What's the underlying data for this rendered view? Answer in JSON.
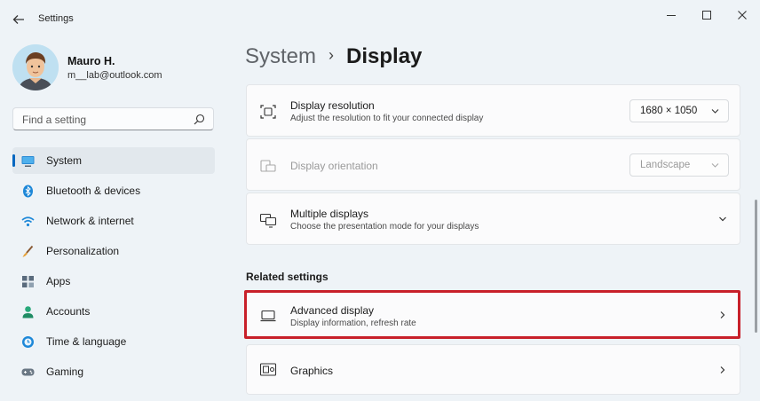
{
  "window": {
    "app_title": "Settings",
    "back_icon": "back-arrow-icon",
    "controls": [
      "minimize-icon",
      "maximize-icon",
      "close-icon"
    ]
  },
  "profile": {
    "name": "Mauro H.",
    "email": "m__lab@outlook.com"
  },
  "search": {
    "placeholder": "Find a setting",
    "value": ""
  },
  "sidebar": {
    "items": [
      {
        "label": "System",
        "icon": "monitor-icon",
        "active": true
      },
      {
        "label": "Bluetooth & devices",
        "icon": "bluetooth-icon"
      },
      {
        "label": "Network & internet",
        "icon": "wifi-icon"
      },
      {
        "label": "Personalization",
        "icon": "brush-icon"
      },
      {
        "label": "Apps",
        "icon": "apps-icon"
      },
      {
        "label": "Accounts",
        "icon": "person-icon"
      },
      {
        "label": "Time & language",
        "icon": "globe-clock-icon"
      },
      {
        "label": "Gaming",
        "icon": "gamepad-icon"
      }
    ]
  },
  "header": {
    "parent": "System",
    "separator": "›",
    "current": "Display"
  },
  "settings": {
    "resolution": {
      "title": "Display resolution",
      "subtitle": "Adjust the resolution to fit your connected display",
      "value": "1680 × 1050",
      "icon": "resolution-icon"
    },
    "orientation": {
      "title": "Display orientation",
      "value": "Landscape",
      "disabled": true,
      "icon": "orientation-icon"
    },
    "multiple": {
      "title": "Multiple displays",
      "subtitle": "Choose the presentation mode for your displays",
      "icon": "multiple-displays-icon"
    }
  },
  "related": {
    "heading": "Related settings",
    "advanced": {
      "title": "Advanced display",
      "subtitle": "Display information, refresh rate",
      "icon": "laptop-icon",
      "highlighted": true
    },
    "graphics": {
      "title": "Graphics",
      "icon": "graphics-icon"
    }
  },
  "colors": {
    "accent": "#0067c0",
    "highlight": "#c8202a",
    "background": "#eef3f7"
  }
}
